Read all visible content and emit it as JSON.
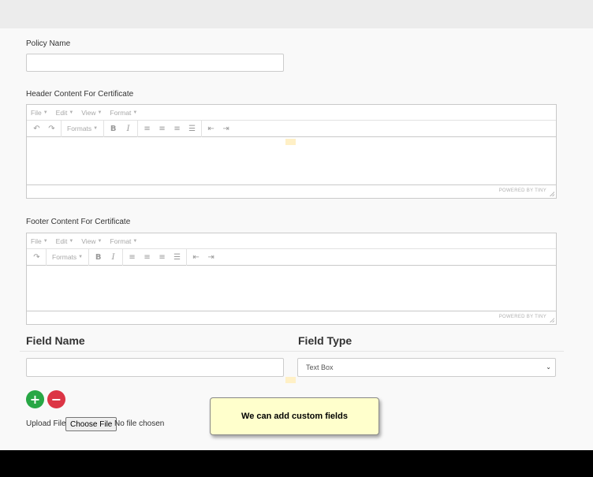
{
  "form": {
    "policy_name_label": "Policy Name",
    "policy_name_value": "",
    "header_label": "Header Content For Certificate",
    "footer_label": "Footer Content For Certificate",
    "field_name_heading": "Field Name",
    "field_type_heading": "Field Type",
    "field_name_value": "",
    "field_type_selected": "Text Box",
    "upload_label": "Upload File",
    "choose_file_label": "Choose File",
    "file_status": "No file chosen"
  },
  "editor": {
    "menu": [
      "File",
      "Edit",
      "View",
      "Format"
    ],
    "formats_label": "Formats",
    "bold_glyph": "B",
    "italic_glyph": "I",
    "powered_by": "POWERED BY TINY"
  },
  "buttons": {
    "add_glyph": "+",
    "remove_glyph": "−"
  },
  "tooltip": {
    "text": "We can add custom fields"
  }
}
